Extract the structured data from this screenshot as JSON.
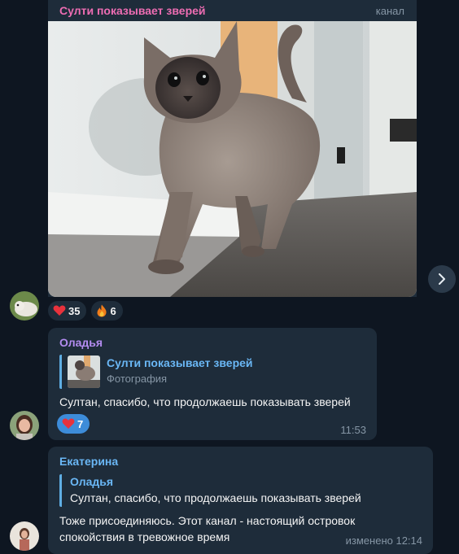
{
  "post": {
    "channel_name": "Султи показывает зверей",
    "type_label": "канал",
    "reactions": [
      {
        "emoji": "heart",
        "count": "35"
      },
      {
        "emoji": "fire",
        "count": "6"
      }
    ]
  },
  "msg1": {
    "sender": "Оладья",
    "reply_title": "Султи показывает зверей",
    "reply_sub": "Фотография",
    "text": "Султан, спасибо, что продолжаешь показывать зверей",
    "reaction_count": "7",
    "time": "11:53"
  },
  "msg2": {
    "sender": "Екатерина",
    "reply_title": "Оладья",
    "reply_text": "Султан, спасибо, что продолжаешь показывать зверей",
    "text_line1": "Тоже присоединяюсь. Этот канал - настоящий островок",
    "text_line2": "спокойствия в тревожное время",
    "time": "изменено 12:14"
  },
  "colors": {
    "background": "#0e1621",
    "bubble": "#1e2c3a",
    "channel_name": "#ee6db3",
    "sender1": "#b38cf0",
    "sender2": "#6ab7f5",
    "accent": "#3d8cd9"
  },
  "icons": {
    "forward": "chevron-right-icon",
    "heart": "heart-icon",
    "fire": "fire-icon"
  }
}
